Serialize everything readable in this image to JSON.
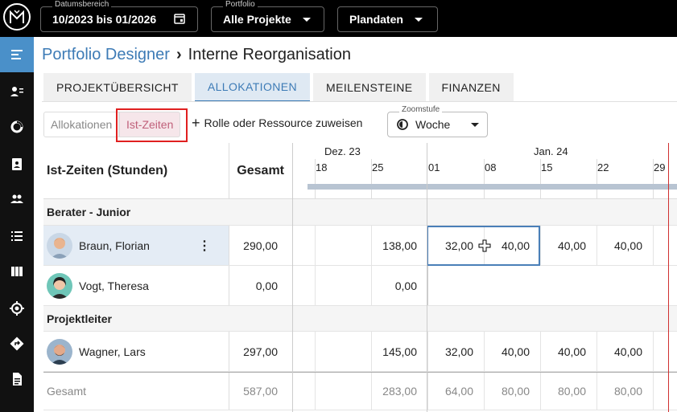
{
  "topbar": {
    "date_range": {
      "label": "Datumsbereich",
      "value": "10/2023 bis 01/2026"
    },
    "portfolio": {
      "label": "Portfolio",
      "value": "Alle Projekte"
    },
    "data_mode": {
      "value": "Plandaten"
    }
  },
  "sidebar": {
    "icons": [
      "menu-icon",
      "person-list-icon",
      "donut-icon",
      "clipboard-person-icon",
      "people-icon",
      "list-icon",
      "columns-icon",
      "target-icon",
      "directions-icon",
      "document-icon"
    ]
  },
  "breadcrumb": {
    "parent": "Portfolio Designer",
    "separator": "›",
    "current": "Interne Reorganisation"
  },
  "tabs": [
    {
      "label": "PROJEKTÜBERSICHT",
      "active": false
    },
    {
      "label": "ALLOKATIONEN",
      "active": true
    },
    {
      "label": "MEILENSTEINE",
      "active": false
    },
    {
      "label": "FINANZEN",
      "active": false
    }
  ],
  "toolbar": {
    "toggle_alloc": "Allokationen",
    "toggle_ist": "Ist-Zeiten",
    "assign": "Rolle oder Ressource zuweisen",
    "zoom_label": "Zoomstufe",
    "zoom_value": "Woche"
  },
  "grid": {
    "title": "Ist-Zeiten (Stunden)",
    "total_header": "Gesamt",
    "months": [
      "Dez. 23",
      "Jan. 24"
    ],
    "weeks": [
      "18",
      "25",
      "01",
      "08",
      "15",
      "22",
      "29"
    ],
    "groups": [
      {
        "label": "Berater - Junior",
        "people": [
          {
            "name": "Braun, Florian",
            "total": "290,00",
            "cells": [
              "",
              "",
              "138,00",
              "32,00",
              "40,00",
              "40,00",
              "40,00",
              ""
            ]
          },
          {
            "name": "Vogt, Theresa",
            "total": "0,00",
            "cells": [
              "",
              "",
              "0,00",
              "",
              "",
              "",
              "",
              ""
            ]
          }
        ]
      },
      {
        "label": "Projektleiter",
        "people": [
          {
            "name": "Wagner, Lars",
            "total": "297,00",
            "cells": [
              "",
              "",
              "145,00",
              "32,00",
              "40,00",
              "40,00",
              "40,00",
              ""
            ]
          }
        ]
      }
    ],
    "footer": {
      "label": "Gesamt",
      "total": "587,00",
      "cells": [
        "",
        "",
        "283,00",
        "64,00",
        "80,00",
        "80,00",
        "80,00",
        ""
      ]
    }
  },
  "colors": {
    "accent": "#3d7bb6",
    "highlight": "#e02020",
    "today_line": "#d03030"
  }
}
